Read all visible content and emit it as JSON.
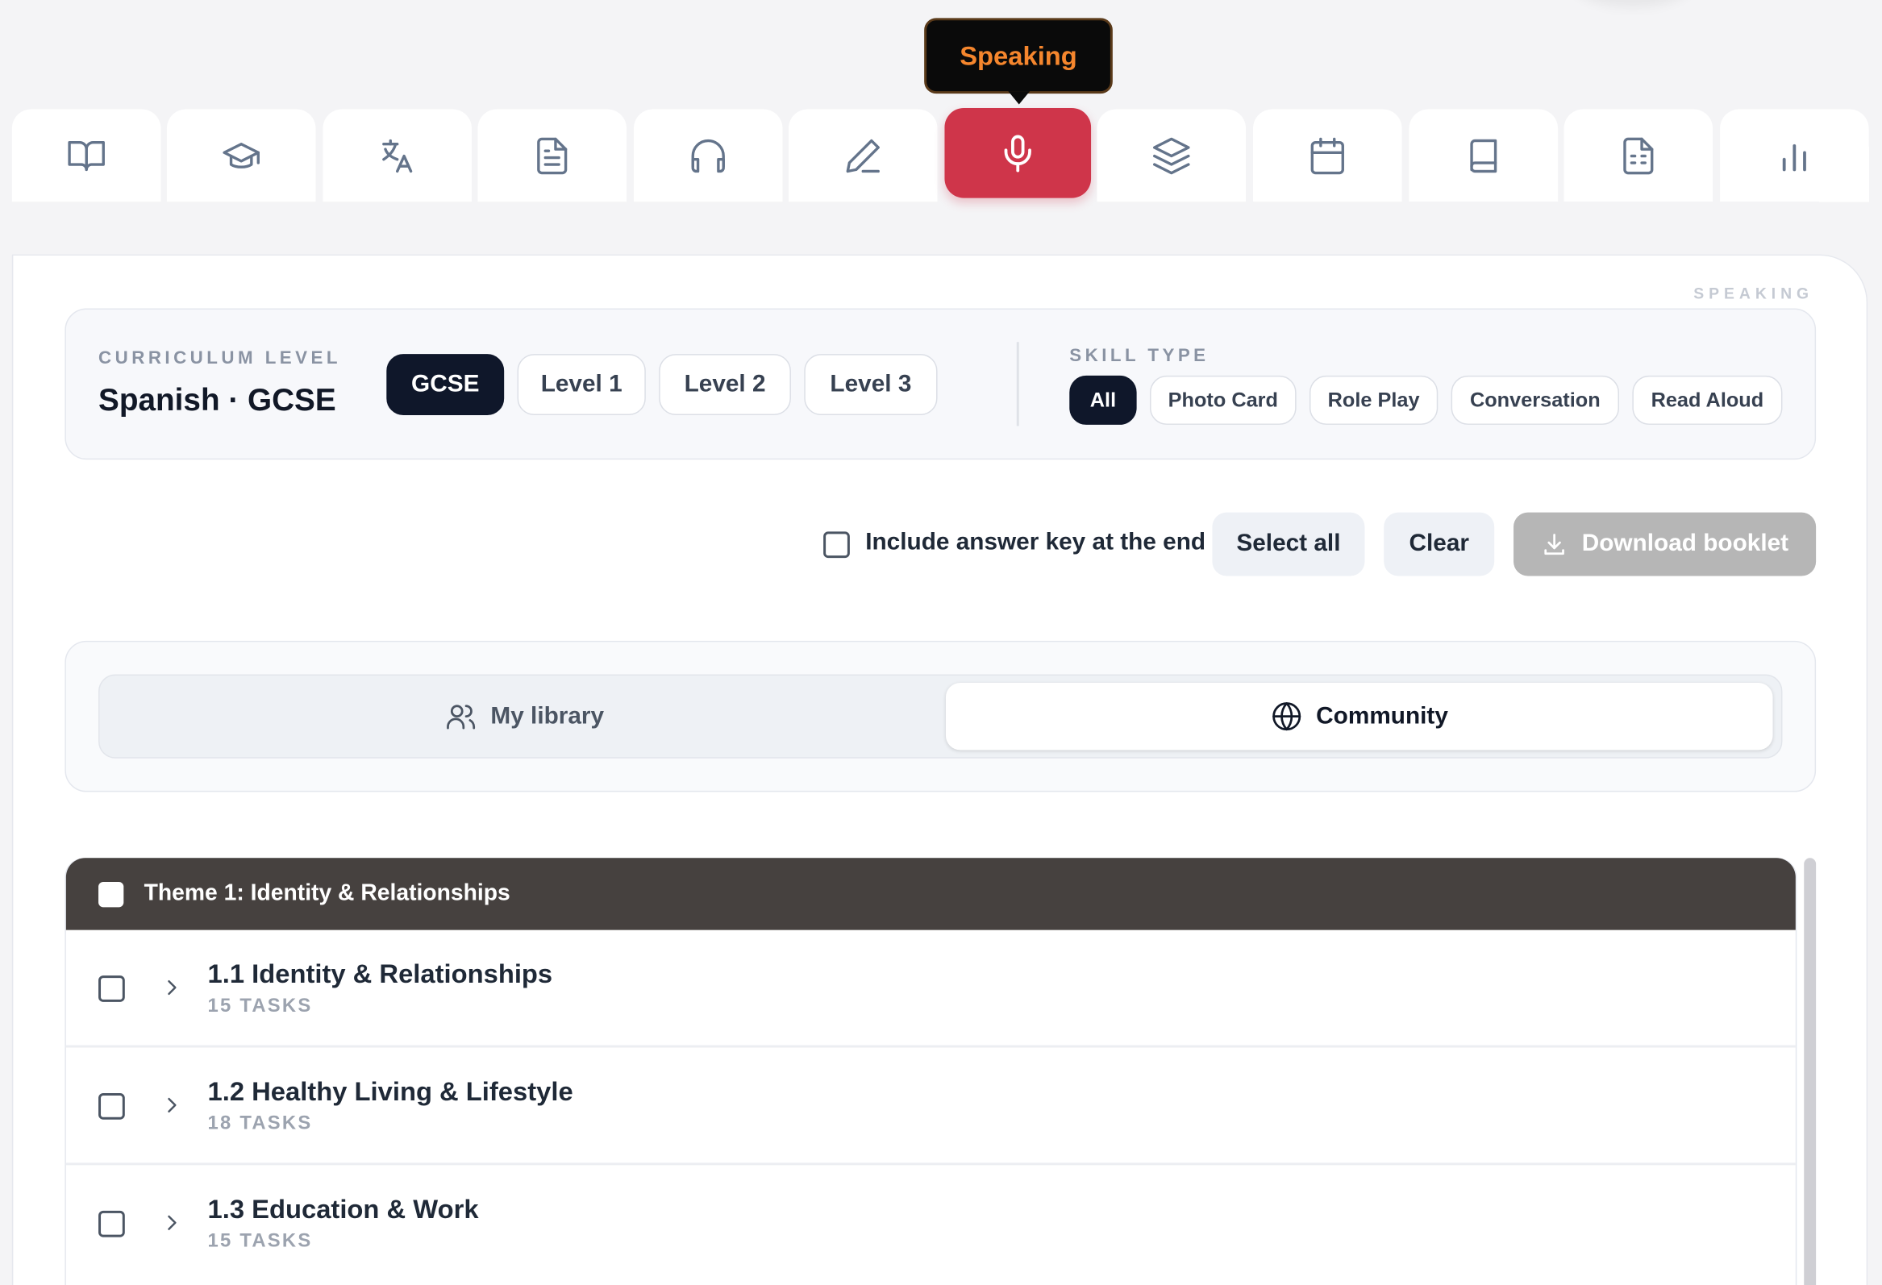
{
  "tooltip": {
    "text": "Speaking"
  },
  "tabs": [
    {
      "icon": "book-open-icon"
    },
    {
      "icon": "graduation-cap-icon"
    },
    {
      "icon": "translate-icon"
    },
    {
      "icon": "document-icon"
    },
    {
      "icon": "headphones-icon"
    },
    {
      "icon": "pencil-icon"
    },
    {
      "icon": "microphone-icon",
      "active": true
    },
    {
      "icon": "layers-icon"
    },
    {
      "icon": "calendar-icon"
    },
    {
      "icon": "book-icon"
    },
    {
      "icon": "worksheet-icon"
    },
    {
      "icon": "bar-chart-icon"
    }
  ],
  "colors": {
    "accent": "#cf354a",
    "tooltip_text": "#f5862d",
    "header_bg": "#46413f",
    "dark_pill": "#0f172a"
  },
  "section_tag": "SPEAKING",
  "curriculum": {
    "label": "CURRICULUM LEVEL",
    "title": "Spanish · GCSE",
    "levels": [
      "GCSE",
      "Level 1",
      "Level 2",
      "Level 3"
    ],
    "selected_level": "GCSE"
  },
  "skill_type": {
    "label": "SKILL TYPE",
    "options": [
      "All",
      "Photo Card",
      "Role Play",
      "Conversation",
      "Read Aloud"
    ],
    "selected": "All"
  },
  "actions": {
    "answer_key_label": "Include answer key at the end",
    "answer_key_checked": false,
    "select_all": "Select all",
    "clear": "Clear",
    "download": "Download booklet"
  },
  "library": {
    "my_library": "My library",
    "community": "Community",
    "selected": "Community"
  },
  "theme": {
    "title": "Theme 1: Identity & Relationships",
    "rows": [
      {
        "title": "1.1 Identity & Relationships",
        "count": "15 TASKS"
      },
      {
        "title": "1.2 Healthy Living & Lifestyle",
        "count": "18 TASKS"
      },
      {
        "title": "1.3 Education & Work",
        "count": "15 TASKS"
      }
    ]
  }
}
